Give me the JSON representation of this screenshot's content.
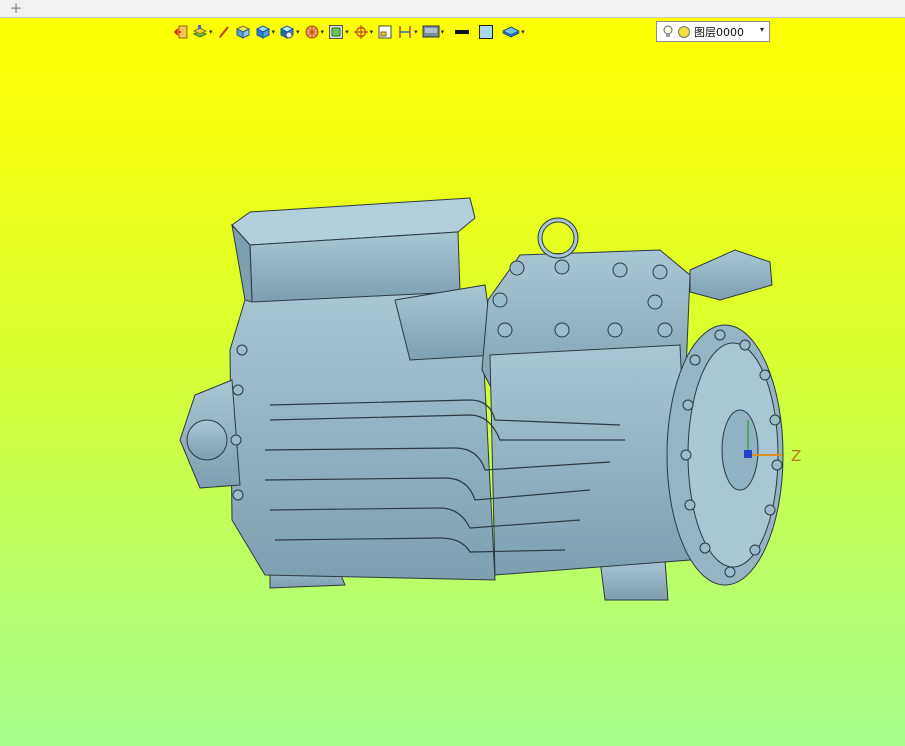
{
  "tabbar": {
    "add_label": "+"
  },
  "toolbar": {
    "buttons": [
      {
        "name": "exit-icon",
        "has_dropdown": false
      },
      {
        "name": "layers-icon",
        "has_dropdown": true
      },
      {
        "name": "brush-icon",
        "has_dropdown": false
      },
      {
        "name": "box-icon",
        "has_dropdown": false
      },
      {
        "name": "solid-cube-icon",
        "has_dropdown": true
      },
      {
        "name": "shaded-view-icon",
        "has_dropdown": true
      },
      {
        "name": "sphere-icon",
        "has_dropdown": true
      },
      {
        "name": "frame-icon",
        "has_dropdown": true
      },
      {
        "name": "target-icon",
        "has_dropdown": true
      },
      {
        "name": "small-frame-icon",
        "has_dropdown": false
      },
      {
        "name": "dimension-icon",
        "has_dropdown": true
      },
      {
        "name": "display-icon",
        "has_dropdown": true
      },
      {
        "name": "line-width-icon",
        "has_dropdown": false
      },
      {
        "name": "color-swatch-icon",
        "has_dropdown": false
      },
      {
        "name": "layer-stack-icon",
        "has_dropdown": true
      }
    ],
    "dropdown_glyph": "▾"
  },
  "layer_selector": {
    "value": "图层0000",
    "arrow": "▾"
  },
  "colors": {
    "bg_top": "#ffff00",
    "bg_bottom": "#a8ff8e",
    "model": "#8fb3c3",
    "model_shade": "#6f93a4",
    "edge": "#2c3a42"
  },
  "viewport": {
    "axis_z_label": "Z"
  }
}
